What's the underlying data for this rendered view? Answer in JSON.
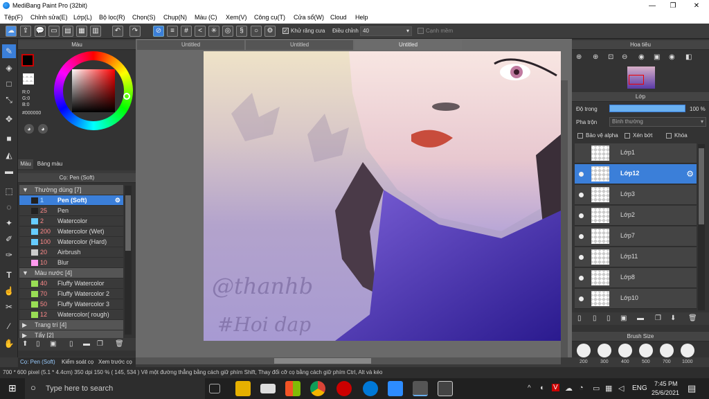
{
  "window": {
    "title": "MediBang Paint Pro (32bit)",
    "minimize": "—",
    "maximize": "❐",
    "close": "✕"
  },
  "menu": [
    "Tệp(F)",
    "Chỉnh sửa(E)",
    "Lớp(L)",
    "Bộ lọc(R)",
    "Chọn(S)",
    "Chụp(N)",
    "Màu (C)",
    "Xem(V)",
    "Công cụ(T)",
    "Cửa sổ(W)",
    "Cloud",
    "Help"
  ],
  "toolbar": {
    "antialias_label": "Khử răng cưa",
    "adjust_label": "Điều chỉnh",
    "adjust_value": "40",
    "smooth_label": "Cạnh mềm"
  },
  "tabs": [
    "Untitled",
    "Untitled",
    "Untitled"
  ],
  "color_panel": {
    "title": "Màu",
    "r": "R:0",
    "g": "G:0",
    "b": "B:0",
    "hex": "#000000",
    "tab1": "Màu",
    "tab2": "Bảng màu"
  },
  "brush_panel": {
    "title": "Cọ: Pen (Soft)",
    "rows": [
      {
        "type": "group",
        "label": "Thường dùng [7]",
        "arrow": "▼"
      },
      {
        "type": "brush",
        "size": "1",
        "name": "Pen (Soft)",
        "color": "#222222",
        "selected": true
      },
      {
        "type": "brush",
        "size": "25",
        "name": "Pen",
        "color": "#222222"
      },
      {
        "type": "brush",
        "size": "2",
        "name": "Watercolor",
        "color": "#66ccff"
      },
      {
        "type": "brush",
        "size": "200",
        "name": "Watercolor (Wet)",
        "color": "#66ccff"
      },
      {
        "type": "brush",
        "size": "100",
        "name": "Watercolor (Hard)",
        "color": "#66ccff"
      },
      {
        "type": "brush",
        "size": "20",
        "name": "Airbrush",
        "color": "#cccccc"
      },
      {
        "type": "brush",
        "size": "10",
        "name": "Blur",
        "color": "#ff99ee"
      },
      {
        "type": "group",
        "label": "Màu nước [4]",
        "arrow": "▼"
      },
      {
        "type": "brush",
        "size": "40",
        "name": "Fluffy Watercolor",
        "color": "#99dd55"
      },
      {
        "type": "brush",
        "size": "70",
        "name": "Fluffy Watercolor 2",
        "color": "#99dd55"
      },
      {
        "type": "brush",
        "size": "50",
        "name": "Fluffy Watercolor 3",
        "color": "#99dd55"
      },
      {
        "type": "brush",
        "size": "12",
        "name": "Watercolor( rough)",
        "color": "#99dd55"
      },
      {
        "type": "group",
        "label": "Trang trí [4]",
        "arrow": "▶"
      },
      {
        "type": "group",
        "label": "Tẩy [2]",
        "arrow": "▶"
      }
    ],
    "bottom_tabs": [
      "Cọ: Pen (Soft)",
      "Kiểm soát cọ",
      "Xem trước cọ"
    ]
  },
  "navigator": {
    "title": "Hoa tiêu"
  },
  "layer_panel": {
    "title": "Lớp",
    "opacity_label": "Độ trong",
    "opacity_value": "100 %",
    "blend_label": "Pha trộn",
    "blend_value": "Bình thường",
    "protect_alpha": "Bảo vệ alpha",
    "clip": "Xén bớt",
    "lock": "Khóa",
    "layers": [
      {
        "name": "Lớp1",
        "selected": false
      },
      {
        "name": "Lớp12",
        "selected": true
      },
      {
        "name": "Lớp3",
        "selected": false
      },
      {
        "name": "Lớp2",
        "selected": false
      },
      {
        "name": "Lớp7",
        "selected": false
      },
      {
        "name": "Lớp11",
        "selected": false
      },
      {
        "name": "Lớp8",
        "selected": false
      },
      {
        "name": "Lớp10",
        "selected": false
      }
    ]
  },
  "brush_size_panel": {
    "title": "Brush Size",
    "sizes": [
      "200",
      "300",
      "400",
      "500",
      "700",
      "1000"
    ]
  },
  "status": {
    "text": "700 * 600 pixel  (5.1 * 4.4cm)  350 dpi  150 %  ( 145, 534 )  Vẽ một đường thẳng bằng cách giữ phím Shift, Thay đổi cỡ cọ bằng cách giữ phím Ctrl, Alt và kéo"
  },
  "taskbar": {
    "search_placeholder": "Type here to search",
    "lang": "ENG",
    "time": "7:45 PM",
    "date": "25/6/2021"
  },
  "artwork": {
    "watermark_line1": "@thanhb",
    "watermark_line2": "#Hoi dap"
  },
  "colors": {
    "accent": "#3b7fd9",
    "panel": "#333333",
    "header": "#444444"
  }
}
